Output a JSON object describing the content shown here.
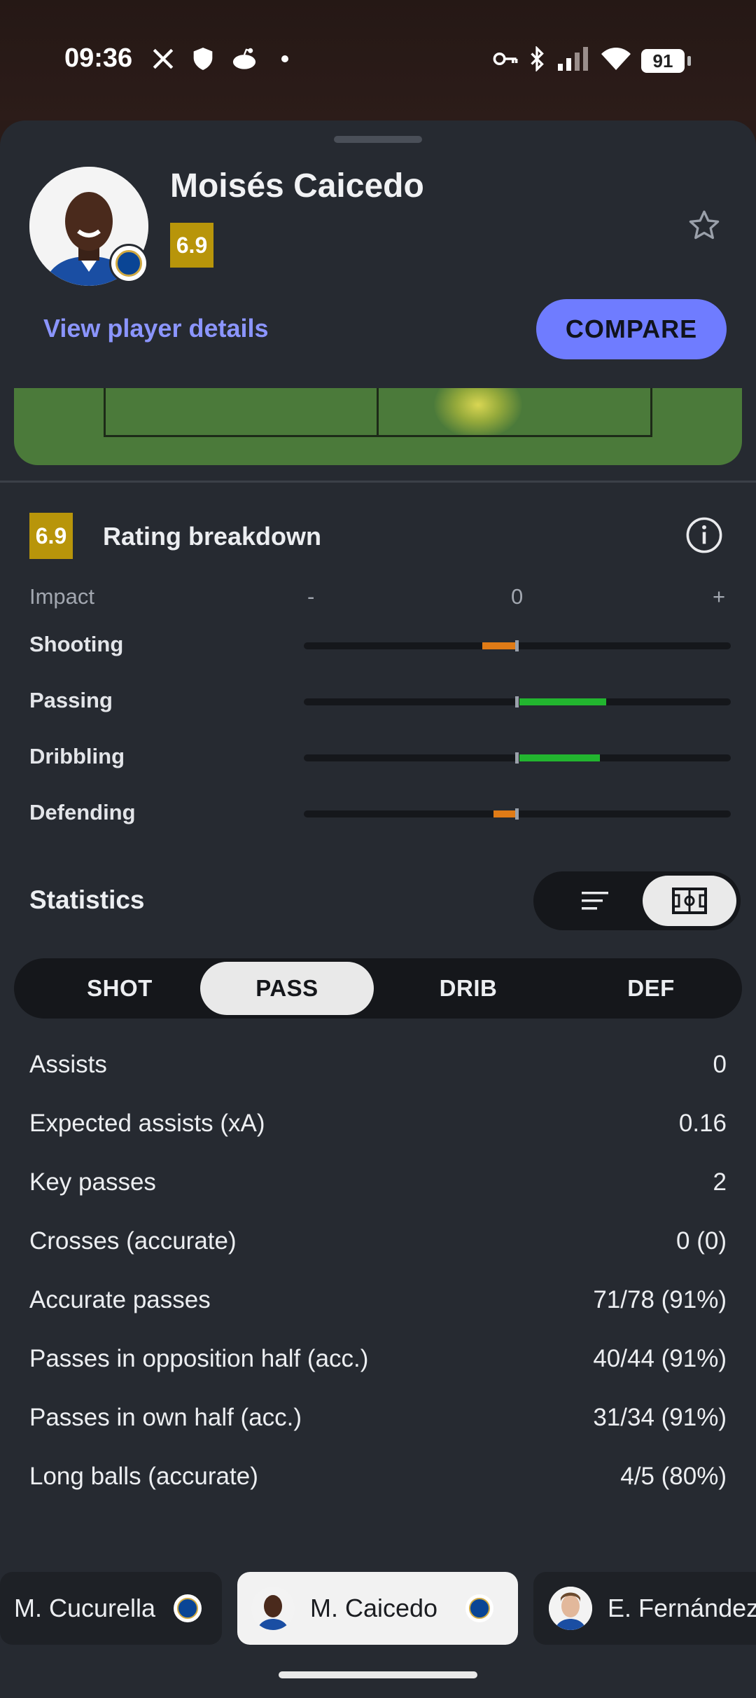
{
  "status_bar": {
    "time": "09:36",
    "battery": "91"
  },
  "player": {
    "name": "Moisés Caicedo",
    "rating": "6.9"
  },
  "header": {
    "details_link": "View player details",
    "compare_label": "COMPARE"
  },
  "rating_breakdown": {
    "rating": "6.9",
    "title": "Rating breakdown",
    "impact_label": "Impact",
    "axis_minus": "-",
    "axis_zero": "0",
    "axis_plus": "+",
    "metrics": [
      {
        "label": "Shooting",
        "impact": -0.06,
        "color": "#e07b16"
      },
      {
        "label": "Passing",
        "impact": 0.15,
        "color": "#22b52f"
      },
      {
        "label": "Dribbling",
        "impact": 0.14,
        "color": "#22b52f"
      },
      {
        "label": "Defending",
        "impact": -0.04,
        "color": "#e07b16"
      }
    ]
  },
  "statistics": {
    "title": "Statistics",
    "tabs": [
      {
        "label": "SHOT",
        "active": false
      },
      {
        "label": "PASS",
        "active": true
      },
      {
        "label": "DRIB",
        "active": false
      },
      {
        "label": "DEF",
        "active": false
      }
    ],
    "rows": [
      {
        "label": "Assists",
        "value": "0"
      },
      {
        "label": "Expected assists (xA)",
        "value": "0.16"
      },
      {
        "label": "Key passes",
        "value": "2"
      },
      {
        "label": "Crosses (accurate)",
        "value": "0 (0)"
      },
      {
        "label": "Accurate passes",
        "value": "71/78 (91%)"
      },
      {
        "label": "Passes in opposition half (acc.)",
        "value": "40/44 (91%)"
      },
      {
        "label": "Passes in own half (acc.)",
        "value": "31/34 (91%)"
      },
      {
        "label": "Long balls (accurate)",
        "value": "4/5 (80%)"
      }
    ]
  },
  "carousel": [
    {
      "name": "M. Cucurella",
      "active": false
    },
    {
      "name": "M. Caicedo",
      "active": true
    },
    {
      "name": "E. Fernández",
      "active": false
    }
  ],
  "colors": {
    "accent": "#6f7cff",
    "rating": "#b8950a",
    "sheet": "#262a31"
  }
}
